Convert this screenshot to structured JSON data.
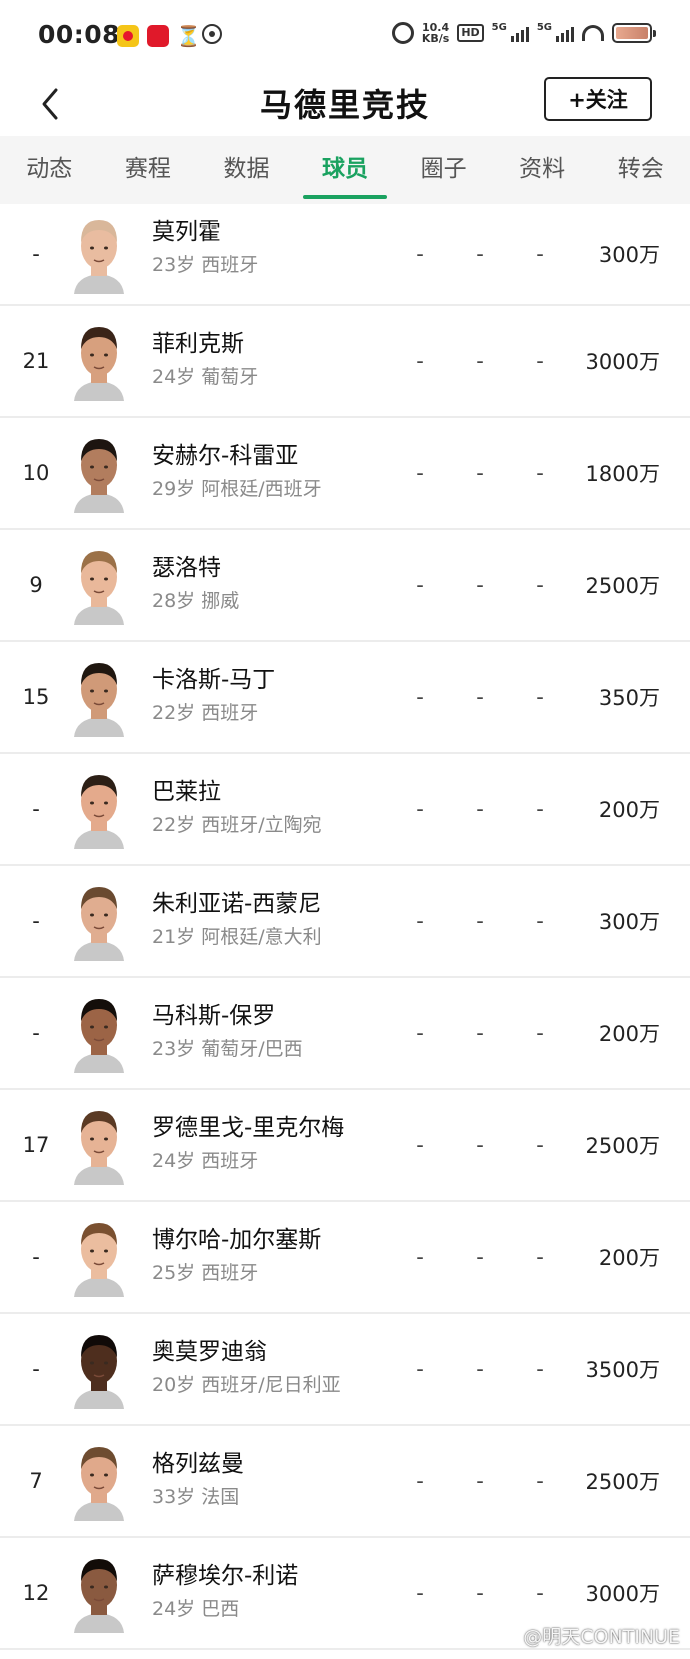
{
  "status_bar": {
    "time": "00:08",
    "net_speed_value": "10.4",
    "net_speed_unit": "KB/s",
    "hd_label": "HD",
    "network_label_1": "5G",
    "network_label_2": "5G"
  },
  "header": {
    "title": "马德里竞技",
    "follow_label": "+关注"
  },
  "tabs": [
    {
      "label": "动态",
      "active": false
    },
    {
      "label": "赛程",
      "active": false
    },
    {
      "label": "数据",
      "active": false
    },
    {
      "label": "球员",
      "active": true
    },
    {
      "label": "圈子",
      "active": false
    },
    {
      "label": "资料",
      "active": false
    },
    {
      "label": "转会",
      "active": false
    }
  ],
  "players": [
    {
      "number": "-",
      "name": "莫列霍",
      "info": "23岁 西班牙",
      "stat1": "-",
      "stat2": "-",
      "stat3": "-",
      "value": "300万",
      "skin": "#e9bca0",
      "hair": "#d9b79a"
    },
    {
      "number": "21",
      "name": "菲利克斯",
      "info": "24岁 葡萄牙",
      "stat1": "-",
      "stat2": "-",
      "stat3": "-",
      "value": "3000万",
      "skin": "#d7a07e",
      "hair": "#3a2418"
    },
    {
      "number": "10",
      "name": "安赫尔-科雷亚",
      "info": "29岁 阿根廷/西班牙",
      "stat1": "-",
      "stat2": "-",
      "stat3": "-",
      "value": "1800万",
      "skin": "#b27d5e",
      "hair": "#1d1510"
    },
    {
      "number": "9",
      "name": "瑟洛特",
      "info": "28岁 挪威",
      "stat1": "-",
      "stat2": "-",
      "stat3": "-",
      "value": "2500万",
      "skin": "#e9b89a",
      "hair": "#9b7148"
    },
    {
      "number": "15",
      "name": "卡洛斯-马丁",
      "info": "22岁 西班牙",
      "stat1": "-",
      "stat2": "-",
      "stat3": "-",
      "value": "350万",
      "skin": "#d09a78",
      "hair": "#201710"
    },
    {
      "number": "-",
      "name": "巴莱拉",
      "info": "22岁 西班牙/立陶宛",
      "stat1": "-",
      "stat2": "-",
      "stat3": "-",
      "value": "200万",
      "skin": "#e4aa8c",
      "hair": "#2c1f16"
    },
    {
      "number": "-",
      "name": "朱利亚诺-西蒙尼",
      "info": "21岁 阿根廷/意大利",
      "stat1": "-",
      "stat2": "-",
      "stat3": "-",
      "value": "300万",
      "skin": "#e0ad90",
      "hair": "#6a4a30"
    },
    {
      "number": "-",
      "name": "马科斯-保罗",
      "info": "23岁 葡萄牙/巴西",
      "stat1": "-",
      "stat2": "-",
      "stat3": "-",
      "value": "200万",
      "skin": "#9c6446",
      "hair": "#140e0a"
    },
    {
      "number": "17",
      "name": "罗德里戈-里克尔梅",
      "info": "24岁 西班牙",
      "stat1": "-",
      "stat2": "-",
      "stat3": "-",
      "value": "2500万",
      "skin": "#e6b395",
      "hair": "#5a3a24"
    },
    {
      "number": "-",
      "name": "博尔哈-加尔塞斯",
      "info": "25岁 西班牙",
      "stat1": "-",
      "stat2": "-",
      "stat3": "-",
      "value": "200万",
      "skin": "#ebbd9f",
      "hair": "#7a5030"
    },
    {
      "number": "-",
      "name": "奥莫罗迪翁",
      "info": "20岁 西班牙/尼日利亚",
      "stat1": "-",
      "stat2": "-",
      "stat3": "-",
      "value": "3500万",
      "skin": "#4e2e1e",
      "hair": "#100a08"
    },
    {
      "number": "7",
      "name": "格列兹曼",
      "info": "33岁 法国",
      "stat1": "-",
      "stat2": "-",
      "stat3": "-",
      "value": "2500万",
      "skin": "#e0a98b",
      "hair": "#6e4c30"
    },
    {
      "number": "12",
      "name": "萨穆埃尔-利诺",
      "info": "24岁 巴西",
      "stat1": "-",
      "stat2": "-",
      "stat3": "-",
      "value": "3000万",
      "skin": "#8a5a40",
      "hair": "#120c08"
    }
  ],
  "watermark": "@明天CONTINUE",
  "colors": {
    "accent": "#1aa260",
    "tab_bar_bg": "#f5f5f5",
    "divider": "#ececec",
    "secondary_text": "#8a8a8a"
  },
  "icons": {
    "back": "chevron-left-icon",
    "alarm": "alarm-icon",
    "wifi": "wifi-icon",
    "battery": "battery-icon"
  }
}
